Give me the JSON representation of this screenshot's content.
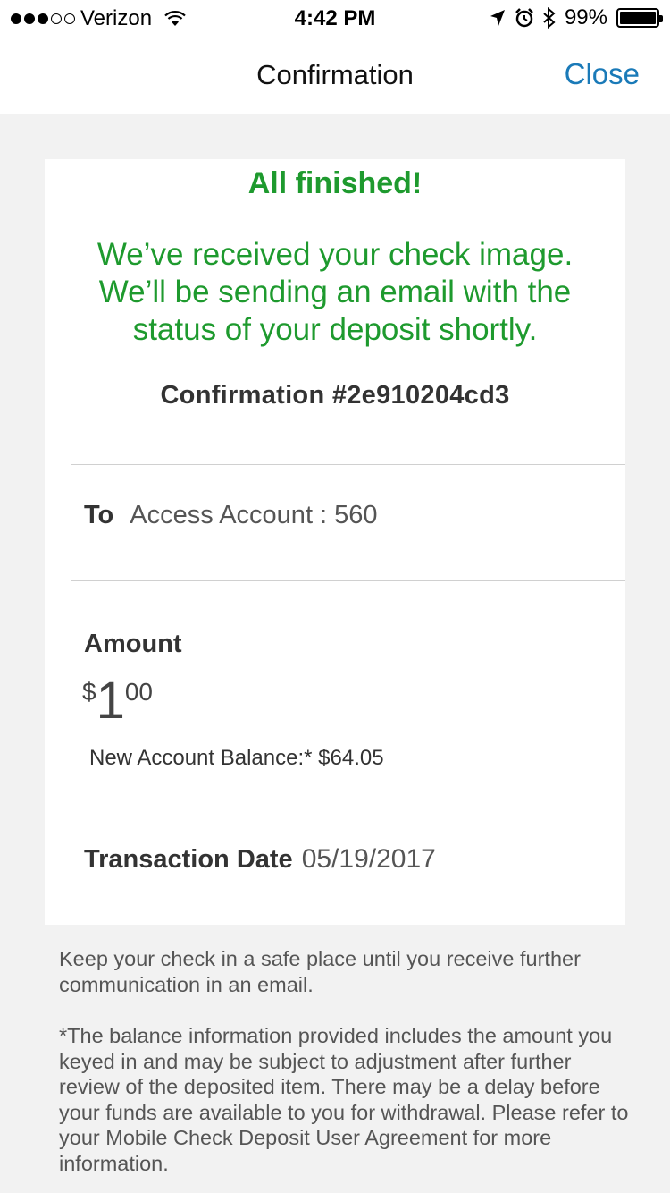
{
  "status_bar": {
    "carrier": "Verizon",
    "time": "4:42 PM",
    "battery": "99%",
    "battery_level": 0.99,
    "signal_bars": 3,
    "signal_total": 5
  },
  "nav": {
    "title": "Confirmation",
    "close_label": "Close"
  },
  "card": {
    "heading": "All finished!",
    "message": "We’ve received your check image. We’ll be sending an email with the status of your deposit shortly.",
    "confirmation": "Confirmation #2e910204cd3",
    "to_label": "To",
    "to_value": "Access Account : 560",
    "amount_label": "Amount",
    "amount_currency": "$",
    "amount_whole": "1",
    "amount_cents": "00",
    "balance_text": "New Account Balance:* $64.05",
    "date_label": "Transaction Date",
    "date_value": "05/19/2017"
  },
  "notes": {
    "note1": "Keep your check in a safe place until you receive further communication in an email.",
    "note2": "*The balance information provided includes the amount you keyed in and may be subject to adjustment after further review of the deposited item. There may be a delay before your funds are available to you for withdrawal. Please refer to your Mobile Check Deposit User Agreement for more information."
  },
  "colors": {
    "success_green": "#1e9a2e",
    "link_blue": "#1a7ab8",
    "background": "#f2f2f2"
  },
  "icons": [
    "signal-dots-icon",
    "wifi-icon",
    "location-arrow-icon",
    "alarm-icon",
    "bluetooth-icon",
    "battery-icon"
  ]
}
